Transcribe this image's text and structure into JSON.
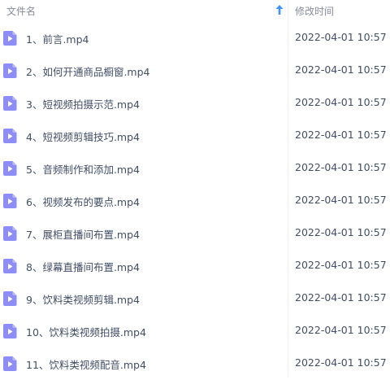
{
  "header": {
    "name_label": "文件名",
    "time_label": "修改时间",
    "sort_icon": "sort-ascending-arrow-icon"
  },
  "colors": {
    "icon_fill": "#8d8ef5",
    "icon_triangle": "#ffffff",
    "sort_arrow": "#3f93f7",
    "text": "#424e67",
    "header_text": "#878c9c"
  },
  "files": [
    {
      "name": "1、前言.mp4",
      "time": "2022-04-01 10:57",
      "icon": "video-file-icon"
    },
    {
      "name": "2、如何开通商品橱窗.mp4",
      "time": "2022-04-01 10:57",
      "icon": "video-file-icon"
    },
    {
      "name": "3、短视频拍摄示范.mp4",
      "time": "2022-04-01 10:57",
      "icon": "video-file-icon"
    },
    {
      "name": "4、短视频剪辑技巧.mp4",
      "time": "2022-04-01 10:57",
      "icon": "video-file-icon"
    },
    {
      "name": "5、音频制作和添加.mp4",
      "time": "2022-04-01 10:57",
      "icon": "video-file-icon"
    },
    {
      "name": "6、视频发布的要点.mp4",
      "time": "2022-04-01 10:57",
      "icon": "video-file-icon"
    },
    {
      "name": "7、展柜直播间布置.mp4",
      "time": "2022-04-01 10:57",
      "icon": "video-file-icon"
    },
    {
      "name": "8、绿幕直播间布置.mp4",
      "time": "2022-04-01 10:57",
      "icon": "video-file-icon"
    },
    {
      "name": "9、饮料类视频剪辑.mp4",
      "time": "2022-04-01 10:57",
      "icon": "video-file-icon"
    },
    {
      "name": "10、饮料类视频拍摄.mp4",
      "time": "2022-04-01 10:57",
      "icon": "video-file-icon"
    },
    {
      "name": "11、饮料类视频配音.mp4",
      "time": "2022-04-01 10:57",
      "icon": "video-file-icon"
    }
  ]
}
